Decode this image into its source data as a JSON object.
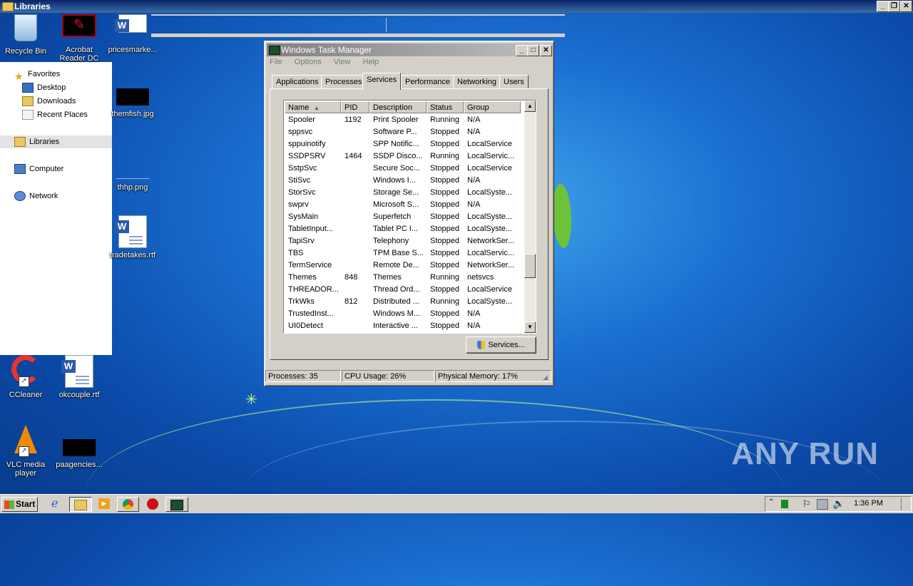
{
  "explorer": {
    "title": "Libraries",
    "nav": {
      "favorites": "Favorites",
      "desktop": "Desktop",
      "downloads": "Downloads",
      "recent_places": "Recent Places",
      "libraries": "Libraries",
      "computer": "Computer",
      "network": "Network"
    }
  },
  "desktop_icons": {
    "recycle_bin": "Recycle Bin",
    "acrobat": "Acrobat Reader DC",
    "pricesmarket": "pricesmarke...",
    "themfish": "themfish.jpg",
    "thhp": "thhp.png",
    "tradetakes": "tradetakes.rtf",
    "ccleaner": "CCleaner",
    "okcouple": "okcouple.rtf",
    "vlc": "VLC media player",
    "paagencies": "paagencies..."
  },
  "task_manager": {
    "title": "Windows Task Manager",
    "menu": [
      "File",
      "Options",
      "View",
      "Help"
    ],
    "tabs": [
      "Applications",
      "Processes",
      "Services",
      "Performance",
      "Networking",
      "Users"
    ],
    "active_tab": "Services",
    "columns": [
      "Name",
      "PID",
      "Description",
      "Status",
      "Group"
    ],
    "sort_column": "Name",
    "rows": [
      [
        "Spooler",
        "1192",
        "Print Spooler",
        "Running",
        "N/A"
      ],
      [
        "sppsvc",
        "",
        "Software P...",
        "Stopped",
        "N/A"
      ],
      [
        "sppuinotify",
        "",
        "SPP Notific...",
        "Stopped",
        "LocalService"
      ],
      [
        "SSDPSRV",
        "1464",
        "SSDP Disco...",
        "Running",
        "LocalServic..."
      ],
      [
        "SstpSvc",
        "",
        "Secure Soc...",
        "Stopped",
        "LocalService"
      ],
      [
        "StiSvc",
        "",
        "Windows I...",
        "Stopped",
        "N/A"
      ],
      [
        "StorSvc",
        "",
        "Storage Se...",
        "Stopped",
        "LocalSyste..."
      ],
      [
        "swprv",
        "",
        "Microsoft S...",
        "Stopped",
        "N/A"
      ],
      [
        "SysMain",
        "",
        "Superfetch",
        "Stopped",
        "LocalSyste..."
      ],
      [
        "TabletInput...",
        "",
        "Tablet PC I...",
        "Stopped",
        "LocalSyste..."
      ],
      [
        "TapiSrv",
        "",
        "Telephony",
        "Stopped",
        "NetworkSer..."
      ],
      [
        "TBS",
        "",
        "TPM Base S...",
        "Stopped",
        "LocalServic..."
      ],
      [
        "TermService",
        "",
        "Remote De...",
        "Stopped",
        "NetworkSer..."
      ],
      [
        "Themes",
        "848",
        "Themes",
        "Running",
        "netsvcs"
      ],
      [
        "THREADOR...",
        "",
        "Thread Ord...",
        "Stopped",
        "LocalService"
      ],
      [
        "TrkWks",
        "812",
        "Distributed ...",
        "Running",
        "LocalSyste..."
      ],
      [
        "TrustedInst...",
        "",
        "Windows M...",
        "Stopped",
        "N/A"
      ],
      [
        "UI0Detect",
        "",
        "Interactive ...",
        "Stopped",
        "N/A"
      ]
    ],
    "services_button": "Services...",
    "status": {
      "processes": "Processes: 35",
      "cpu": "CPU Usage: 26%",
      "memory": "Physical Memory: 17%"
    }
  },
  "taskbar": {
    "start_label": "Start",
    "clock": "1:36 PM"
  },
  "watermark": "ANY RUN",
  "colors": {
    "desktop_blue": "#1a6fd0",
    "title_active": "#0a246a",
    "title_inactive": "#808080",
    "window_face": "#d4d0c8"
  }
}
